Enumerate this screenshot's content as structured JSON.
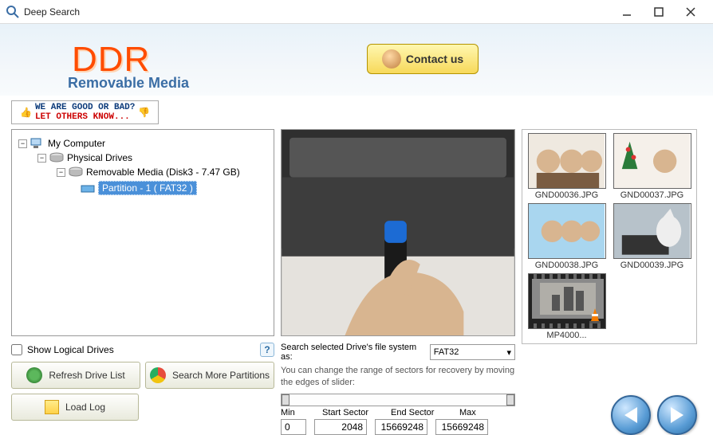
{
  "window": {
    "title": "Deep Search"
  },
  "header": {
    "logo_text": "DDR",
    "logo_subtitle": "Removable Media",
    "contact_label": "Contact us"
  },
  "feedback": {
    "line1": "WE ARE GOOD OR BAD?",
    "line2": "LET OTHERS KNOW..."
  },
  "tree": {
    "root": "My Computer",
    "physical_drives": "Physical Drives",
    "removable": "Removable Media (Disk3 - 7.47 GB)",
    "partition": "Partition - 1 ( FAT32 )"
  },
  "left_controls": {
    "show_logical": "Show Logical Drives",
    "refresh": "Refresh Drive List",
    "search_more": "Search More Partitions",
    "load_log": "Load Log"
  },
  "mid": {
    "fs_label": "Search selected Drive's file system as:",
    "fs_value": "FAT32",
    "hint": "You can change the range of sectors for recovery by moving the edges of slider:",
    "labels": {
      "min": "Min",
      "start": "Start Sector",
      "end": "End Sector",
      "max": "Max"
    },
    "values": {
      "min": "0",
      "start": "2048",
      "end": "15669248",
      "max": "15669248"
    }
  },
  "thumbnails": [
    {
      "name": "GND00036.JPG"
    },
    {
      "name": "GND00037.JPG"
    },
    {
      "name": "GND00038.JPG"
    },
    {
      "name": "GND00039.JPG"
    },
    {
      "name": "MP4000...",
      "video": true
    }
  ]
}
